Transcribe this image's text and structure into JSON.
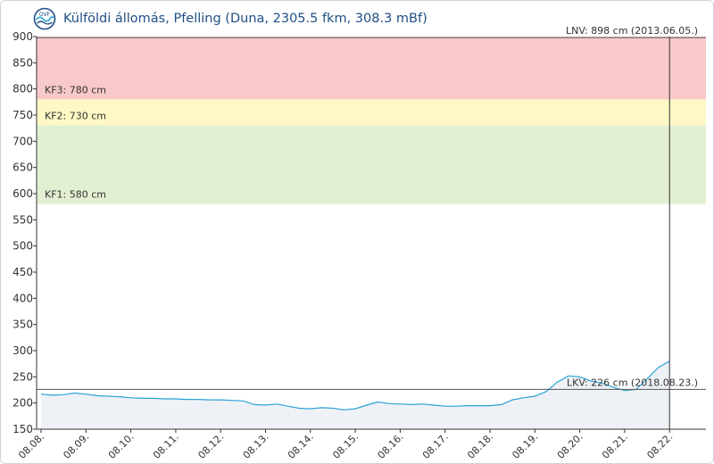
{
  "header": {
    "title": "Külföldi állomás, Pfelling (Duna, 2305.5 fkm, 308.3 mBf)",
    "logo_icon": "wave-logo-icon"
  },
  "colors": {
    "kf3_band": "#f8c9c9",
    "kf2_band": "#fdf8c4",
    "kf1_band": "#e3efd2",
    "line": "#2aa3d6",
    "area": "#eef1f6",
    "ref_line": "#555555",
    "title": "#1f4e85"
  },
  "chart_data": {
    "type": "area",
    "title": "Külföldi állomás, Pfelling (Duna, 2305.5 fkm, 308.3 mBf)",
    "ylim": [
      150,
      900
    ],
    "y_ticks": [
      150,
      200,
      250,
      300,
      350,
      400,
      450,
      500,
      550,
      600,
      650,
      700,
      750,
      800,
      850,
      900
    ],
    "x_ticks": [
      "08.08.",
      "08.09.",
      "08.10.",
      "08.11.",
      "08.12.",
      "08.13.",
      "08.14.",
      "08.15.",
      "08.16.",
      "08.17.",
      "08.18.",
      "08.19.",
      "08.20.",
      "08.21.",
      "08.22."
    ],
    "grid": false,
    "bands": [
      {
        "label": "KF3: 780 cm",
        "from": 780,
        "to": 900,
        "color": "#f8c9c9"
      },
      {
        "label": "KF2: 730 cm",
        "from": 730,
        "to": 780,
        "color": "#fdf8c4"
      },
      {
        "label": "KF1: 580 cm",
        "from": 580,
        "to": 730,
        "color": "#e3efd2"
      }
    ],
    "reference_lines": [
      {
        "label": "LNV: 898 cm (2013.06.05.)",
        "value": 898
      },
      {
        "label": "LKV: 226 cm (2018.08.23.)",
        "value": 226
      }
    ],
    "cursor_x": 14.0,
    "series": [
      {
        "x": [
          0,
          0.25,
          0.5,
          0.75,
          1.0,
          1.25,
          1.5,
          1.75,
          2.0,
          2.25,
          2.5,
          2.75,
          3.0,
          3.25,
          3.5,
          3.75,
          4.0,
          4.25,
          4.5,
          4.75,
          5.0,
          5.25,
          5.5,
          5.75,
          6.0,
          6.25,
          6.5,
          6.75,
          7.0,
          7.25,
          7.5,
          7.75,
          8.0,
          8.25,
          8.5,
          8.75,
          9.0,
          9.25,
          9.5,
          9.75,
          10.0,
          10.25,
          10.5,
          10.75,
          11.0,
          11.25,
          11.5,
          11.75,
          12.0,
          12.25,
          12.5,
          12.75,
          13.0,
          13.25,
          13.5,
          13.75,
          14.0
        ],
        "values": [
          217,
          215,
          216,
          219,
          217,
          214,
          213,
          212,
          210,
          209,
          209,
          208,
          208,
          207,
          207,
          206,
          206,
          205,
          204,
          197,
          196,
          198,
          194,
          190,
          189,
          191,
          190,
          187,
          189,
          196,
          202,
          199,
          198,
          197,
          198,
          196,
          194,
          194,
          195,
          195,
          195,
          197,
          206,
          210,
          213,
          222,
          240,
          252,
          250,
          242,
          238,
          230,
          224,
          226,
          246,
          268,
          280
        ]
      }
    ]
  }
}
